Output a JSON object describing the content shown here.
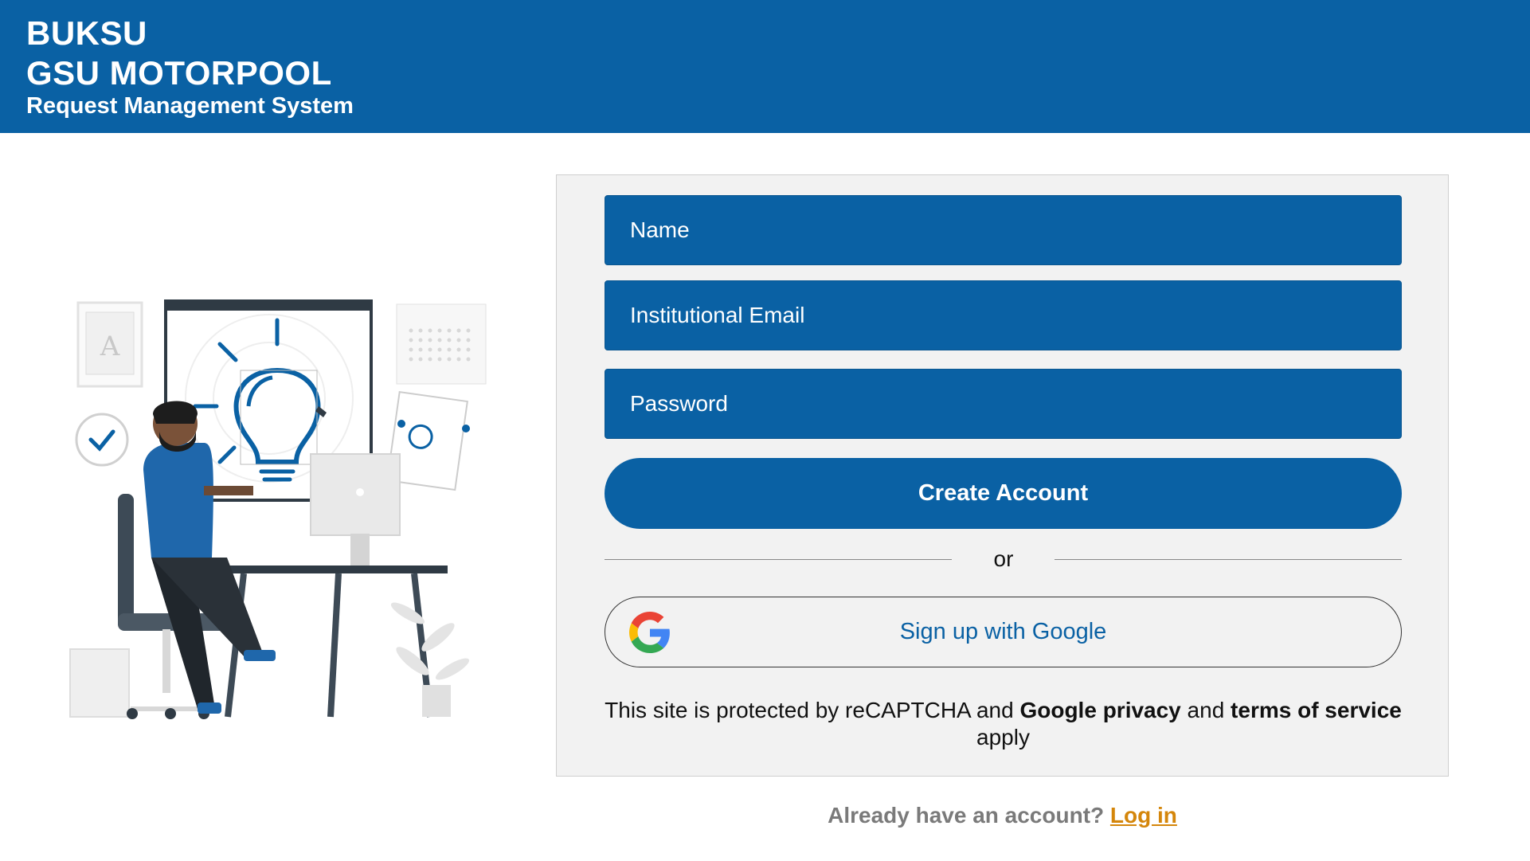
{
  "header": {
    "line1": "BUKSU",
    "line2": "GSU MOTORPOOL",
    "line3": "Request Management System"
  },
  "form": {
    "name_placeholder": "Name",
    "email_placeholder": "Institutional Email",
    "password_placeholder": "Password",
    "create_label": "Create Account",
    "divider_text": "or",
    "google_label": "Sign up with Google"
  },
  "notice": {
    "prefix": "This site is protected by reCAPTCHA and",
    "privacy": "Google privacy",
    "and": "and",
    "terms": "terms of service",
    "suffix": "apply"
  },
  "footer": {
    "question": "Already have an account?",
    "login": "Log in"
  },
  "colors": {
    "primary": "#0a61a4",
    "link": "#d4860b"
  },
  "illustration": {
    "letter": "A"
  }
}
